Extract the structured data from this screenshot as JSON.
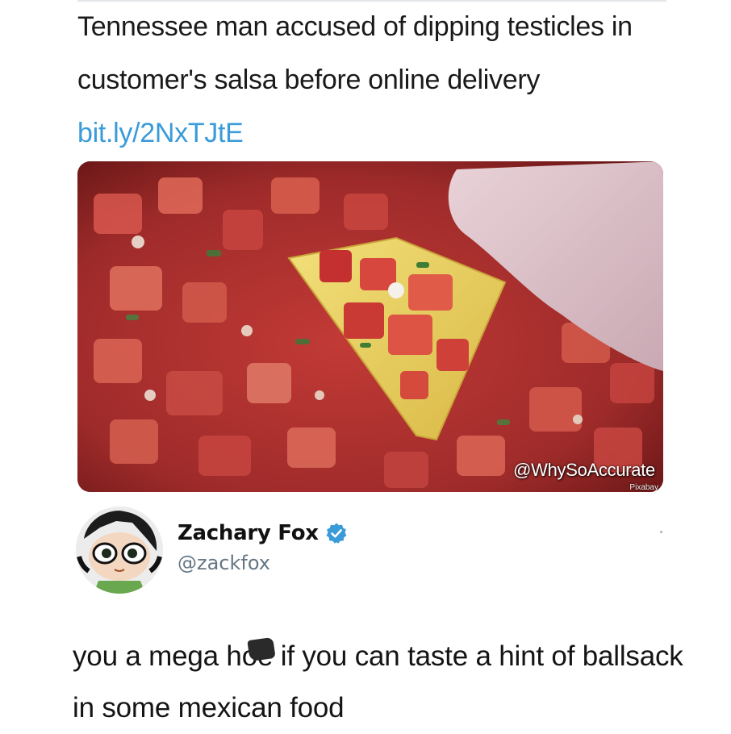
{
  "headline": {
    "text": "Tennessee man accused of dipping testicles in customer's salsa before online delivery ",
    "link": "bit.ly/2NxTJtE"
  },
  "image": {
    "watermark": "@WhySoAccurate",
    "credit": "Pixabay"
  },
  "account": {
    "display_name": "Zachary Fox",
    "handle": "@zackfox",
    "verified": true
  },
  "tweet": {
    "before_censor": "you a mega h",
    "censored_word": "oe",
    "after_censor": " if you can taste a hint of ballsack in some mexican food"
  },
  "colors": {
    "link": "#3a9bd9",
    "verified": "#3a9bd9",
    "handle": "#657786"
  }
}
